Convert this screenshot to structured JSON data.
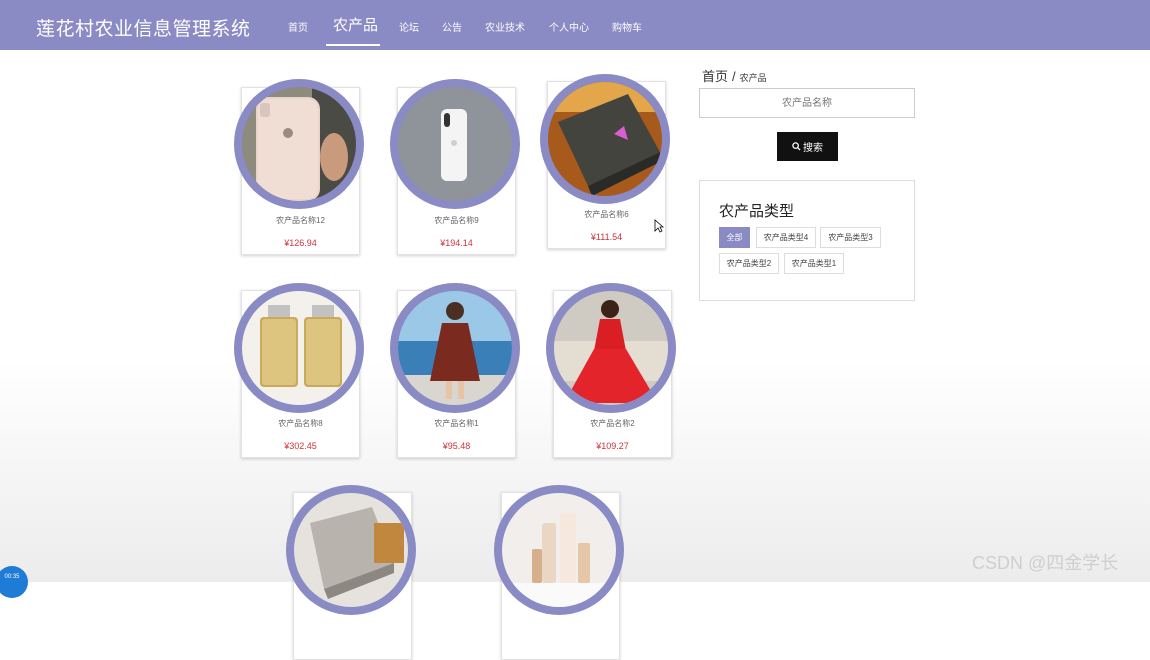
{
  "app": {
    "title": "莲花村农业信息管理系统"
  },
  "nav": {
    "items": [
      {
        "label": "首页"
      },
      {
        "label": "农产品",
        "active": true
      },
      {
        "label": "论坛"
      },
      {
        "label": "公告"
      },
      {
        "label": "农业技术"
      },
      {
        "label": "个人中心"
      },
      {
        "label": "购物车"
      }
    ],
    "accent_color": "#8a8ac4"
  },
  "products": [
    {
      "name": "农产品名称12",
      "price": "¥126.94",
      "image": "rose-gold-phone"
    },
    {
      "name": "农产品名称9",
      "price": "¥194.14",
      "image": "white-phone"
    },
    {
      "name": "农产品名称6",
      "price": "¥111.54",
      "image": "gaming-laptop"
    },
    {
      "name": "农产品名称8",
      "price": "¥302.45",
      "image": "perfume-bottles"
    },
    {
      "name": "农产品名称1",
      "price": "¥95.48",
      "image": "floral-dress"
    },
    {
      "name": "农产品名称2",
      "price": "¥109.27",
      "image": "red-dress"
    },
    {
      "name": "",
      "price": "",
      "image": "laptop-box"
    },
    {
      "name": "",
      "price": "",
      "image": "skincare-set"
    }
  ],
  "breadcrumb": {
    "home": "首页",
    "separator": "/",
    "current": "农产品"
  },
  "search": {
    "placeholder": "农产品名称",
    "button_label": "搜索"
  },
  "types": {
    "title": "农产品类型",
    "tags": [
      {
        "label": "全部",
        "active": true
      },
      {
        "label": "农产品类型4"
      },
      {
        "label": "农产品类型3"
      },
      {
        "label": "农产品类型2"
      },
      {
        "label": "农产品类型1"
      }
    ]
  },
  "watermark": "CSDN @四金学长",
  "timer": "00:35"
}
